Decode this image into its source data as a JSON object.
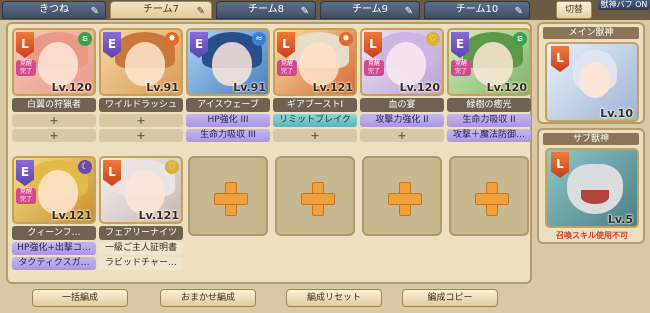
{
  "tabs": [
    {
      "label": "きつね",
      "active": false
    },
    {
      "label": "チーム7",
      "active": true
    },
    {
      "label": "チーム8",
      "active": false
    },
    {
      "label": "チーム9",
      "active": false
    },
    {
      "label": "チーム10",
      "active": false
    }
  ],
  "switch_label": "切替",
  "beast_toggle_label": "獣神バフ ON",
  "units_row1": [
    {
      "name": "白翼の狩猟者",
      "level": "Lv.120",
      "rarity": "L",
      "elem": "wind",
      "skills": [
        "+",
        "+"
      ]
    },
    {
      "name": "ワイルドラッシュ",
      "level": "Lv.91",
      "rarity": "E",
      "elem": "fire",
      "skills": [
        "+",
        "+"
      ]
    },
    {
      "name": "アイスウェーブ",
      "level": "Lv.91",
      "rarity": "E",
      "elem": "water",
      "skills": [
        "HP強化 III",
        "生命力吸収 III"
      ]
    },
    {
      "name": "ギアブーストI",
      "level": "Lv.121",
      "rarity": "L",
      "elem": "fire",
      "skills": [
        "リミットブレイク",
        "+"
      ]
    },
    {
      "name": "血の宴",
      "level": "Lv.120",
      "rarity": "L",
      "elem": "light",
      "skills": [
        "攻撃力強化 II",
        "+"
      ]
    },
    {
      "name": "緑樹の癒光",
      "level": "Lv.120",
      "rarity": "E",
      "elem": "wind",
      "skills": [
        "生命力吸収 II",
        "攻撃＋魔法防御…"
      ]
    }
  ],
  "units_row2": [
    {
      "name": "クィーンフ…",
      "level": "Lv.121",
      "rarity": "E",
      "elem": "dark",
      "skills": [
        "HP強化+出撃コ…",
        "タクティクスガ…"
      ]
    },
    {
      "name": "フェアリーナイツ",
      "level": "Lv.121",
      "rarity": "L",
      "elem": "light",
      "skills": [
        "一級ご主人証明書",
        "ラビッドチャー…"
      ]
    }
  ],
  "main_beast": {
    "title": "メイン獣神",
    "level": "Lv.10",
    "rarity": "L"
  },
  "sub_beast": {
    "title": "サブ獣神",
    "level": "Lv.5",
    "rarity": "L",
    "note": "召喚スキル使用不可"
  },
  "bottom_buttons": [
    "一括編成",
    "おまかせ編成",
    "編成リセット",
    "編成コピー"
  ],
  "colors": {
    "accent": "#f2a03c",
    "tab_active": "#e8d7ae",
    "tab_inactive": "#4a5a73"
  }
}
